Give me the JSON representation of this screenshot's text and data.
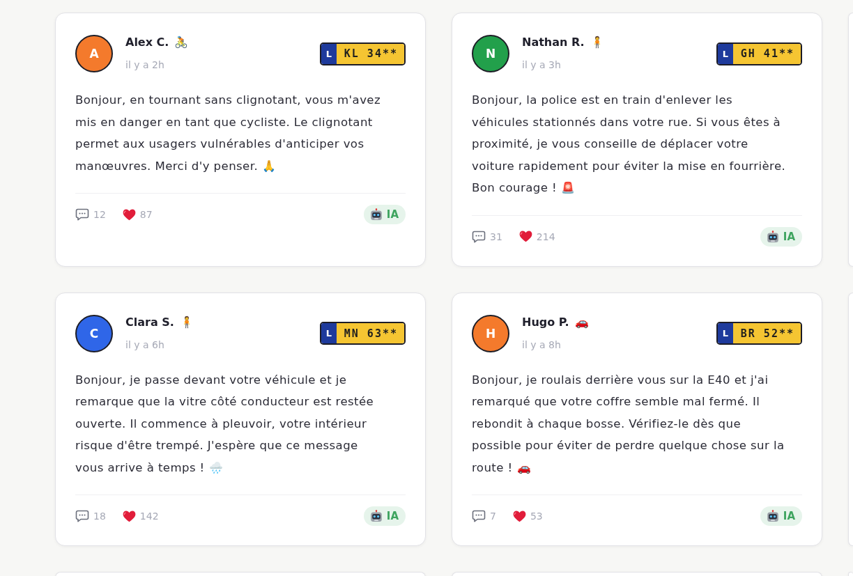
{
  "posts": [
    {
      "avatar": {
        "initial": "A",
        "color": "#f47a2c"
      },
      "author": "Alex C.",
      "author_emoji": "🚴",
      "time": "il y a 2h",
      "plate": {
        "prefix": "L",
        "number": "KL 34**"
      },
      "message": {
        "text": "Bonjour, en tournant sans clignotant, vous m'avez mis en danger en tant que cycliste. Le clignotant permet aux usagers vulnérables d'anticiper vos manœuvres. Merci d'y penser.",
        "emoji": "🙏"
      },
      "comments": "12",
      "likes": "87",
      "ai_badge": "IA"
    },
    {
      "avatar": {
        "initial": "N",
        "color": "#22a04b"
      },
      "author": "Nathan R.",
      "author_emoji": "🧍",
      "time": "il y a 3h",
      "plate": {
        "prefix": "L",
        "number": "GH 41**"
      },
      "message": {
        "text": "Bonjour, la police est en train d'enlever les véhicules stationnés dans votre rue. Si vous êtes à proximité, je vous conseille de déplacer votre voiture rapidement pour éviter la mise en fourrière. Bon courage !",
        "emoji": "🚨"
      },
      "comments": "31",
      "likes": "214",
      "ai_badge": "IA"
    },
    {
      "avatar": {
        "initial": "C",
        "color": "#2f66e8"
      },
      "author": "Clara S.",
      "author_emoji": "🧍",
      "time": "il y a 6h",
      "plate": {
        "prefix": "L",
        "number": "MN 63**"
      },
      "message": {
        "text": "Bonjour, je passe devant votre véhicule et je remarque que la vitre côté conducteur est restée ouverte. Il commence à pleuvoir, votre intérieur risque d'être trempé. J'espère que ce message vous arrive à temps !",
        "emoji": "🌧️"
      },
      "comments": "18",
      "likes": "142",
      "ai_badge": "IA"
    },
    {
      "avatar": {
        "initial": "H",
        "color": "#f47a2c"
      },
      "author": "Hugo P.",
      "author_emoji": "🚗",
      "time": "il y a 8h",
      "plate": {
        "prefix": "L",
        "number": "BR 52**"
      },
      "message": {
        "text": "Bonjour, je roulais derrière vous sur la E40 et j'ai remarqué que votre coffre semble mal fermé. Il rebondit à chaque bosse. Vérifiez-le dès que possible pour éviter de perdre quelque chose sur la route !",
        "emoji": "🚗"
      },
      "comments": "7",
      "likes": "53",
      "ai_badge": "IA"
    }
  ]
}
